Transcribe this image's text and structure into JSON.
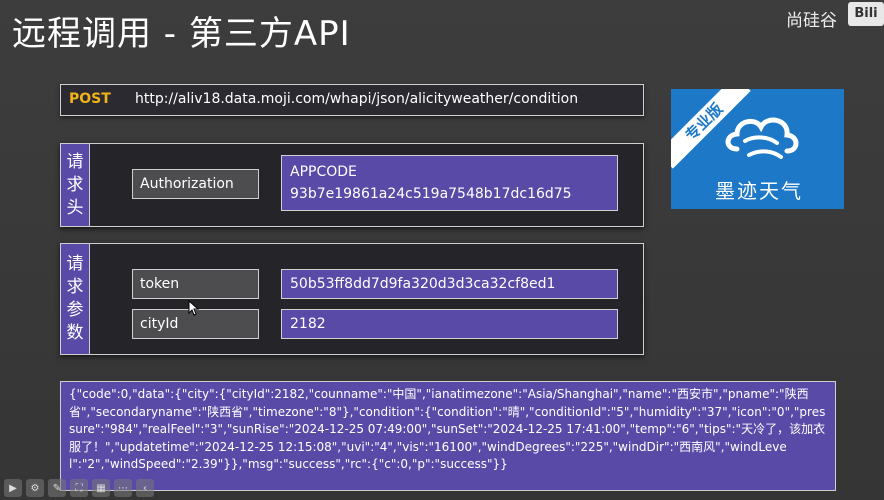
{
  "slide": {
    "title": "远程调用 - 第三方API",
    "brand": "尚硅谷",
    "bili_logo": "Bili"
  },
  "request": {
    "method": "POST",
    "url": "http://aliv18.data.moji.com/whapi/json/alicityweather/condition"
  },
  "headers_panel": {
    "side_label": [
      "请",
      "求",
      "头"
    ],
    "rows": [
      {
        "key": "Authorization",
        "value_line1": "APPCODE",
        "value_line2": "93b7e19861a24c519a7548b17dc16d75"
      }
    ]
  },
  "params_panel": {
    "side_label": [
      "请",
      "求",
      "参",
      "数"
    ],
    "rows": [
      {
        "key": "token",
        "value": "50b53ff8dd7d9fa320d3d3ca32cf8ed1"
      },
      {
        "key": "cityId",
        "value": "2182"
      }
    ]
  },
  "logo": {
    "ribbon": "专业版",
    "name": "墨迹天气",
    "brand_color": "#1e78c8"
  },
  "response": {
    "json_text": "{\"code\":0,\"data\":{\"city\":{\"cityId\":2182,\"counname\":\"中国\",\"ianatimezone\":\"Asia/Shanghai\",\"name\":\"西安市\",\"pname\":\"陕西省\",\"secondaryname\":\"陕西省\",\"timezone\":\"8\"},\"condition\":{\"condition\":\"晴\",\"conditionId\":\"5\",\"humidity\":\"37\",\"icon\":\"0\",\"pressure\":\"984\",\"realFeel\":\"3\",\"sunRise\":\"2024-12-25 07:49:00\",\"sunSet\":\"2024-12-25 17:41:00\",\"temp\":\"6\",\"tips\":\"天冷了，该加衣服了！\",\"updatetime\":\"2024-12-25 12:15:08\",\"uvi\":\"4\",\"vis\":\"16100\",\"windDegrees\":\"225\",\"windDir\":\"西南风\",\"windLevel\":\"2\",\"windSpeed\":\"2.39\"}},\"msg\":\"success\",\"rc\":{\"c\":0,\"p\":\"success\"}}"
  },
  "colors": {
    "panel_accent": "#5a4aa8",
    "method_color": "#f1b21a"
  },
  "toolbar": {
    "icons": [
      "play-icon",
      "settings-icon",
      "pen-icon",
      "fullscreen-icon",
      "grid-icon",
      "more-icon",
      "prev-icon"
    ]
  }
}
